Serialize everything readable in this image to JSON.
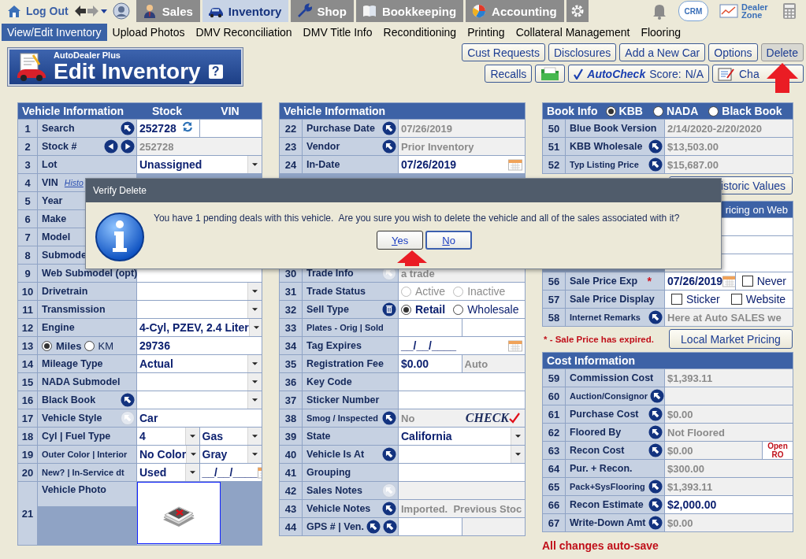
{
  "topbar": {
    "logout": "Log Out",
    "tabs": [
      {
        "label": "Sales",
        "selected": false
      },
      {
        "label": "Inventory",
        "selected": true
      },
      {
        "label": "Shop",
        "selected": false
      },
      {
        "label": "Bookkeeping",
        "selected": false
      },
      {
        "label": "Accounting",
        "selected": false
      }
    ],
    "crm": "CRM",
    "dealer_zone": "Dealer Zone"
  },
  "subnav": [
    {
      "label": "View/Edit Inventory",
      "selected": true
    },
    {
      "label": "Upload Photos",
      "selected": false
    },
    {
      "label": "DMV Reconciliation",
      "selected": false
    },
    {
      "label": "DMV Title Info",
      "selected": false
    },
    {
      "label": "Reconditioning",
      "selected": false
    },
    {
      "label": "Printing",
      "selected": false
    },
    {
      "label": "Collateral Management",
      "selected": false
    },
    {
      "label": "Flooring",
      "selected": false
    }
  ],
  "header": {
    "brand": "AutoDealer Plus",
    "title": "Edit Inventory",
    "help": "?"
  },
  "actions": {
    "row1": [
      {
        "label": "Cust Requests",
        "pressed": false
      },
      {
        "label": "Disclosures",
        "pressed": false
      },
      {
        "label": "Add a New Car",
        "pressed": false
      },
      {
        "label": "Options",
        "pressed": false
      },
      {
        "label": "Delete",
        "pressed": true
      }
    ],
    "recalls": "Recalls",
    "autocheck": {
      "brand": "AutoCheck",
      "score_label": "Score:",
      "score": "N/A"
    },
    "charting": "Cha"
  },
  "columns": [
    {
      "items": [
        {
          "kind": "section",
          "title": "Vehicle Information",
          "columns": [
            "Stock",
            "VIN"
          ],
          "rows": [
            {
              "n": "1",
              "label": "Search",
              "lookups": [
                {
                  "disabled": false
                }
              ],
              "cells": [
                {
                  "kind": "search",
                  "value": "252728"
                },
                {
                  "kind": "input"
                }
              ]
            },
            {
              "n": "2",
              "label": "Stock #",
              "pager": true,
              "cells": [
                {
                  "kind": "readonly",
                  "value": "252728"
                }
              ]
            },
            {
              "n": "3",
              "label": "Lot",
              "cells": [
                {
                  "kind": "select",
                  "value": "Unassigned"
                }
              ]
            },
            {
              "n": "4",
              "label": "VIN",
              "link": "Histo"
            },
            {
              "n": "5",
              "label": "Year"
            },
            {
              "n": "6",
              "label": "Make"
            },
            {
              "n": "7",
              "label": "Model"
            },
            {
              "n": "8",
              "label": "Submode"
            },
            {
              "n": "9",
              "label": "Web Submodel (opt)",
              "cells": [
                {
                  "kind": "input"
                }
              ]
            },
            {
              "n": "10",
              "label": "Drivetrain",
              "cells": [
                {
                  "kind": "select"
                }
              ]
            },
            {
              "n": "11",
              "label": "Transmission",
              "cells": [
                {
                  "kind": "select"
                }
              ]
            },
            {
              "n": "12",
              "label": "Engine",
              "cells": [
                {
                  "kind": "select",
                  "value": "4-Cyl, PZEV, 2.4 Liter"
                }
              ]
            },
            {
              "n": "13",
              "radios": [
                {
                  "label": "Miles",
                  "selected": true
                },
                {
                  "label": "KM",
                  "selected": false
                }
              ],
              "cells": [
                {
                  "kind": "input",
                  "value": "29736"
                }
              ]
            },
            {
              "n": "14",
              "label": "Mileage Type",
              "cells": [
                {
                  "kind": "select",
                  "value": "Actual"
                }
              ]
            },
            {
              "n": "15",
              "label": "NADA Submodel",
              "cells": [
                {
                  "kind": "select"
                }
              ]
            },
            {
              "n": "16",
              "label": "Black Book",
              "lookups": [
                {
                  "disabled": false
                }
              ],
              "cells": [
                {
                  "kind": "select"
                }
              ]
            },
            {
              "n": "17",
              "label": "Vehicle Style",
              "lookups": [
                {
                  "disabled": true
                }
              ],
              "cells": [
                {
                  "kind": "input",
                  "value": "Car"
                }
              ]
            },
            {
              "n": "18",
              "label": "Cyl | Fuel Type",
              "cells": [
                {
                  "kind": "select",
                  "value": "4"
                },
                {
                  "kind": "select",
                  "value": "Gas"
                }
              ]
            },
            {
              "n": "19",
              "label": "Outer Color | Interior",
              "cells": [
                {
                  "kind": "select",
                  "value": "No Color"
                },
                {
                  "kind": "select",
                  "value": "Gray"
                }
              ]
            },
            {
              "n": "20",
              "label": "New? | In-Service dt",
              "cells": [
                {
                  "kind": "select",
                  "value": "Used"
                },
                {
                  "kind": "date",
                  "value": "__/__/____"
                }
              ]
            },
            {
              "n": "21",
              "label": "Vehicle Photo",
              "cells": [
                {
                  "kind": "photo"
                }
              ]
            }
          ]
        }
      ]
    },
    {
      "items": [
        {
          "kind": "section",
          "title": "Vehicle Information",
          "rows": [
            {
              "n": "22",
              "label": "Purchase Date",
              "lookups": [
                {
                  "disabled": false
                }
              ],
              "cells": [
                {
                  "kind": "readonly",
                  "value": "07/26/2019"
                }
              ]
            },
            {
              "n": "23",
              "label": "Vendor",
              "lookups": [
                {
                  "disabled": false
                }
              ],
              "cells": [
                {
                  "kind": "readonly",
                  "value": "Prior Inventory"
                }
              ]
            },
            {
              "n": "24",
              "label": "In-Date",
              "cells": [
                {
                  "kind": "date",
                  "value": "07/26/2019"
                }
              ]
            },
            {
              "n": "30",
              "label": "Trade Info",
              "lookups": [
                {
                  "disabled": true
                }
              ],
              "cells": [
                {
                  "kind": "readonly",
                  "value": "a trade"
                }
              ]
            },
            {
              "n": "31",
              "label": "Trade Status",
              "cells": [
                {
                  "kind": "radios",
                  "disabled": true,
                  "options": [
                    {
                      "label": "Active",
                      "selected": false
                    },
                    {
                      "label": "Inactive",
                      "selected": false
                    }
                  ]
                }
              ]
            },
            {
              "n": "32",
              "label": "Sell Type",
              "delete_action": true,
              "cells": [
                {
                  "kind": "radios",
                  "disabled": false,
                  "options": [
                    {
                      "label": "Retail",
                      "selected": true
                    },
                    {
                      "label": "Wholesale",
                      "selected": false
                    }
                  ]
                }
              ]
            },
            {
              "n": "33",
              "label": "Plates - Orig | Sold",
              "cells": [
                {
                  "kind": "input"
                },
                {
                  "kind": "input"
                }
              ]
            },
            {
              "n": "34",
              "label": "Tag Expires",
              "cells": [
                {
                  "kind": "date",
                  "value": "__/__/____"
                }
              ]
            },
            {
              "n": "35",
              "label": "Registration Fee",
              "cells": [
                {
                  "kind": "input",
                  "value": "$0.00"
                },
                {
                  "kind": "readonly",
                  "value": "Auto"
                }
              ]
            },
            {
              "n": "36",
              "label": "Key Code",
              "cells": [
                {
                  "kind": "input"
                }
              ]
            },
            {
              "n": "37",
              "label": "Sticker Number",
              "cells": [
                {
                  "kind": "input"
                }
              ]
            },
            {
              "n": "38",
              "label": "Smog / Inspected",
              "lookups": [
                {
                  "disabled": false
                }
              ],
              "cells": [
                {
                  "kind": "readonly",
                  "value": "No",
                  "logo": "CHECK"
                }
              ]
            },
            {
              "n": "39",
              "label": "State",
              "cells": [
                {
                  "kind": "select",
                  "value": "California"
                }
              ]
            },
            {
              "n": "40",
              "label": "Vehicle Is At",
              "lookups": [
                {
                  "disabled": false
                }
              ],
              "cells": [
                {
                  "kind": "select"
                }
              ]
            },
            {
              "n": "41",
              "label": "Grouping",
              "cells": [
                {
                  "kind": "input"
                }
              ]
            },
            {
              "n": "42",
              "label": "Sales Notes",
              "lookups": [
                {
                  "disabled": true
                }
              ],
              "cells": [
                {
                  "kind": "readonly"
                }
              ]
            },
            {
              "n": "43",
              "label": "Vehicle Notes",
              "lookups": [
                {
                  "disabled": false
                }
              ],
              "cells": [
                {
                  "kind": "readonly",
                  "value": "Imported.  Previous Stoc"
                }
              ]
            },
            {
              "n": "44",
              "label": "GPS # | Ven.",
              "lookups": [
                {
                  "disabled": false
                },
                {
                  "disabled": false
                }
              ],
              "cells": [
                {
                  "kind": "input"
                },
                {
                  "kind": "readonly"
                }
              ]
            }
          ]
        }
      ]
    },
    {
      "items": [
        {
          "kind": "section",
          "title": "Book Info",
          "radios": [
            {
              "label": "KBB",
              "selected": true
            },
            {
              "label": "NADA",
              "selected": false
            },
            {
              "label": "Black Book",
              "selected": false
            }
          ],
          "rows": [
            {
              "n": "50",
              "label": "Blue Book Version",
              "cells": [
                {
                  "kind": "readonly",
                  "value": "2/14/2020-2/20/2020"
                }
              ]
            },
            {
              "n": "51",
              "label": "KBB Wholesale",
              "lookups": [
                {
                  "disabled": false
                }
              ],
              "cells": [
                {
                  "kind": "readonly",
                  "value": "$13,503.00"
                }
              ]
            },
            {
              "n": "52",
              "label": "Typ Listing Price",
              "lookups": [
                {
                  "disabled": false
                }
              ],
              "cells": [
                {
                  "kind": "readonly",
                  "value": "$15,687.00"
                }
              ]
            }
          ]
        },
        {
          "kind": "button",
          "label": "istoric Values"
        },
        {
          "kind": "section",
          "title": "ricing on Web",
          "rows": [
            {
              "n": "56",
              "label": "Sale Price Exp",
              "required": "*",
              "cells": [
                {
                  "kind": "date",
                  "value": "07/26/2019"
                },
                {
                  "kind": "checks",
                  "options": [
                    {
                      "label": "Never",
                      "checked": false
                    }
                  ]
                }
              ]
            },
            {
              "n": "57",
              "label": "Sale Price Display",
              "cells": [
                {
                  "kind": "checks",
                  "options": [
                    {
                      "label": "Sticker",
                      "checked": false
                    },
                    {
                      "label": "Website",
                      "checked": false
                    }
                  ]
                }
              ]
            },
            {
              "n": "58",
              "label": "Internet Remarks",
              "lookups": [
                {
                  "disabled": false
                }
              ],
              "cells": [
                {
                  "kind": "readonly",
                  "value": "Here at Auto SALES we"
                }
              ]
            }
          ]
        },
        {
          "kind": "note",
          "note": "* - Sale Price has expired.",
          "button": "Local Market Pricing"
        },
        {
          "kind": "section",
          "title": "Cost Information",
          "rows": [
            {
              "n": "59",
              "label": "Commission Cost",
              "cells": [
                {
                  "kind": "readonly",
                  "value": "$1,393.11"
                }
              ]
            },
            {
              "n": "60",
              "label": "Auction/Consignor",
              "lookups": [
                {
                  "disabled": false
                }
              ],
              "cells": [
                {
                  "kind": "readonly"
                }
              ]
            },
            {
              "n": "61",
              "label": "Purchase Cost",
              "lookups": [
                {
                  "disabled": false
                }
              ],
              "cells": [
                {
                  "kind": "readonly",
                  "value": "$0.00"
                }
              ]
            },
            {
              "n": "62",
              "label": "Floored By",
              "lookups": [
                {
                  "disabled": false
                }
              ],
              "cells": [
                {
                  "kind": "readonly",
                  "value": "Not Floored"
                }
              ]
            },
            {
              "n": "63",
              "label": "Recon Cost",
              "lookups": [
                {
                  "disabled": false
                }
              ],
              "cells": [
                {
                  "kind": "readonly",
                  "value": "$0.00"
                },
                {
                  "kind": "open-ro",
                  "value": "Open RO"
                }
              ]
            },
            {
              "n": "64",
              "label": "Pur. + Recon.",
              "cells": [
                {
                  "kind": "readonly",
                  "value": "$300.00"
                }
              ]
            },
            {
              "n": "65",
              "label": "Pack+SysFlooring",
              "lookups": [
                {
                  "disabled": false
                }
              ],
              "cells": [
                {
                  "kind": "readonly",
                  "value": "$1,393.11"
                }
              ]
            },
            {
              "n": "66",
              "label": "Recon Estimate",
              "lookups": [
                {
                  "disabled": false
                }
              ],
              "cells": [
                {
                  "kind": "input",
                  "value": "$2,000.00"
                }
              ]
            },
            {
              "n": "67",
              "label": "Write-Down Amt",
              "lookups": [
                {
                  "disabled": false
                }
              ],
              "cells": [
                {
                  "kind": "readonly",
                  "value": "$0.00"
                }
              ]
            }
          ]
        },
        {
          "kind": "footer",
          "text": "All changes auto-save"
        }
      ]
    }
  ],
  "dialog": {
    "title": "Verify Delete",
    "message": "You have 1 pending deals with this vehicle.  Are you sure you wish to delete the vehicle and all of the sales associated with it?",
    "buttons": [
      "Yes",
      "No"
    ]
  }
}
